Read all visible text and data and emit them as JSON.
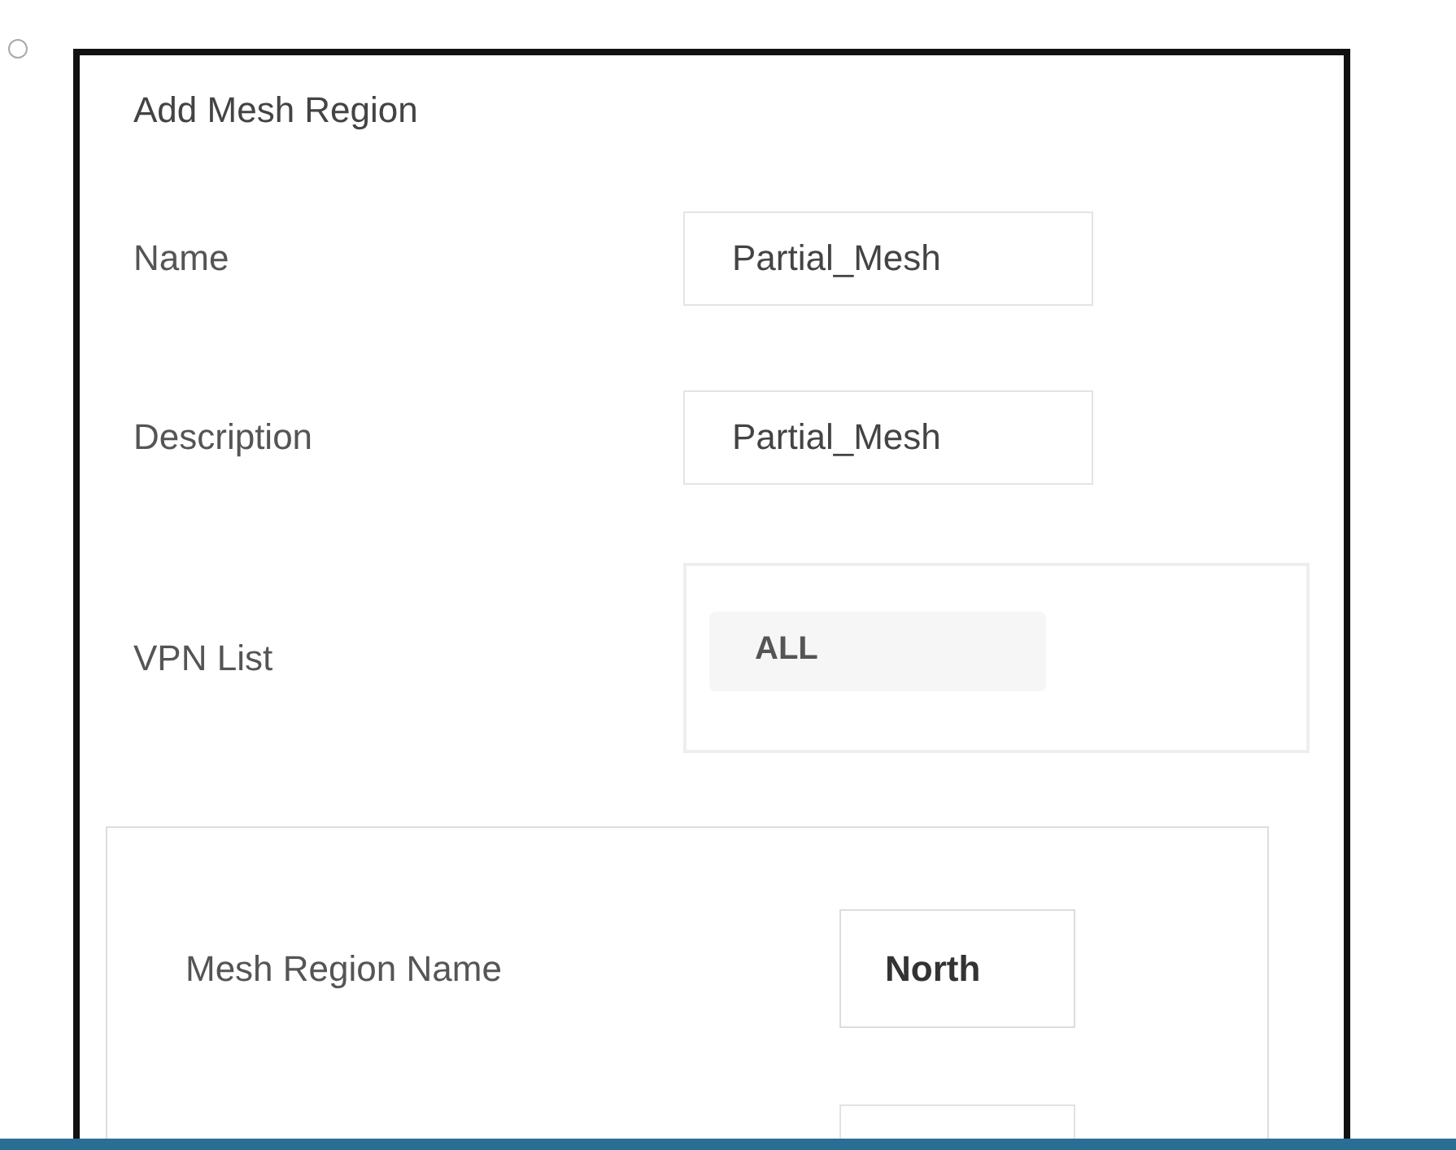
{
  "option": {
    "selected": false
  },
  "dialog": {
    "title": "Add Mesh Region",
    "fields": [
      {
        "label": "Name",
        "value": "Partial_Mesh"
      },
      {
        "label": "Description",
        "value": "Partial_Mesh"
      }
    ],
    "vpn_list": {
      "label": "VPN List",
      "value": "ALL"
    },
    "mesh_region": {
      "label": "Mesh Region Name",
      "value": "North"
    }
  }
}
